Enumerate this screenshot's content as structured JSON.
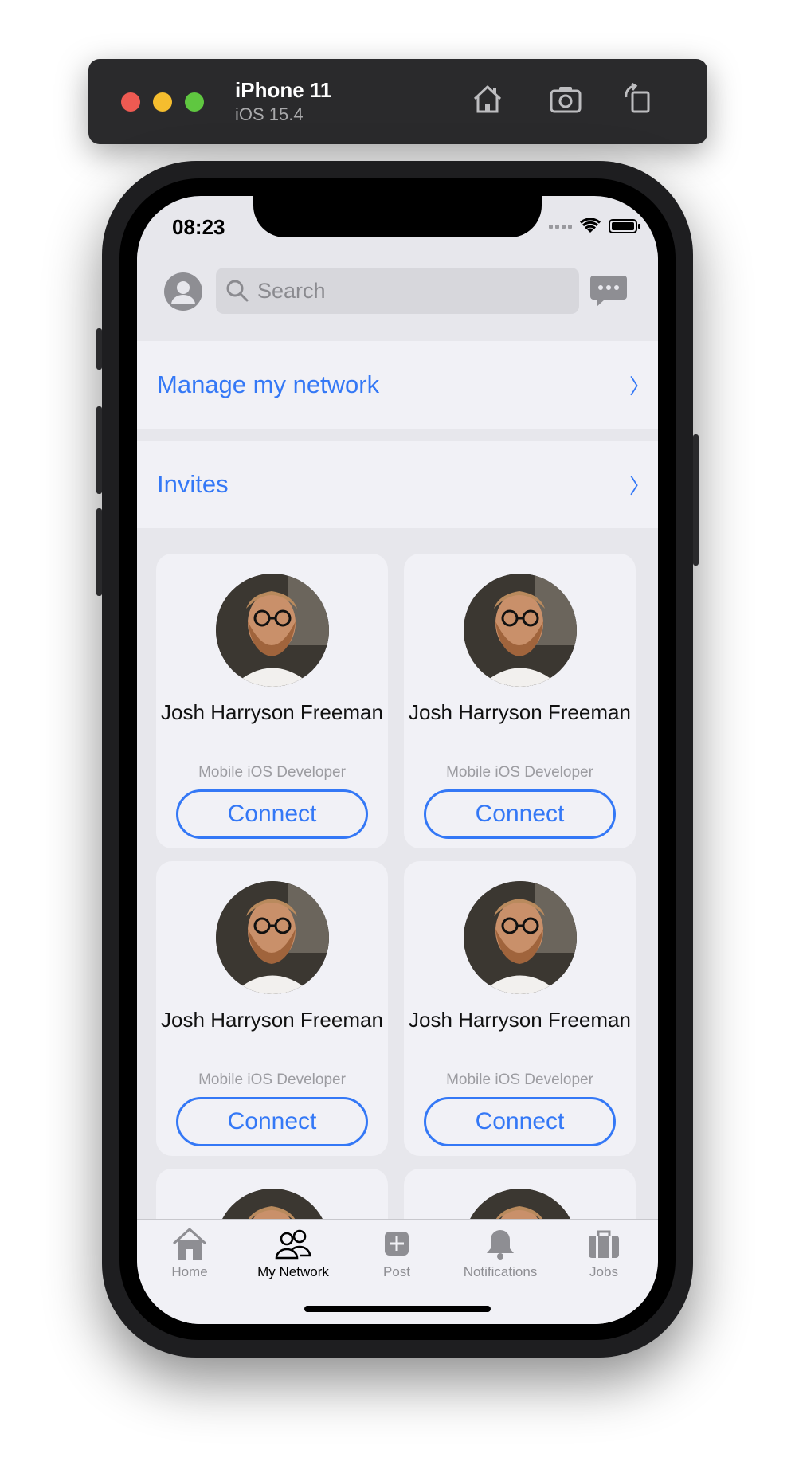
{
  "simulator": {
    "device": "iPhone 11",
    "os": "iOS 15.4",
    "icons": [
      "home-icon",
      "screenshot-icon",
      "rotate-icon"
    ]
  },
  "status_bar": {
    "time": "08:23"
  },
  "header": {
    "search_placeholder": "Search",
    "icons": [
      "profile-avatar-icon",
      "search-icon",
      "messages-icon"
    ]
  },
  "rows": [
    {
      "label": "Manage my network",
      "chevron": "〉"
    },
    {
      "label": "Invites",
      "chevron": "〉"
    }
  ],
  "cards": [
    {
      "name": "Josh Harryson Freeman",
      "role": "Mobile iOS Developer",
      "button": "Connect"
    },
    {
      "name": "Josh Harryson Freeman",
      "role": "Mobile iOS Developer",
      "button": "Connect"
    },
    {
      "name": "Josh Harryson Freeman",
      "role": "Mobile iOS Developer",
      "button": "Connect"
    },
    {
      "name": "Josh Harryson Freeman",
      "role": "Mobile iOS Developer",
      "button": "Connect"
    }
  ],
  "tabs": [
    {
      "label": "Home",
      "icon": "home-icon",
      "active": false
    },
    {
      "label": "My Network",
      "icon": "people-icon",
      "active": true
    },
    {
      "label": "Post",
      "icon": "plus-square-icon",
      "active": false
    },
    {
      "label": "Notifications",
      "icon": "bell-icon",
      "active": false
    },
    {
      "label": "Jobs",
      "icon": "briefcase-icon",
      "active": false
    }
  ],
  "colors": {
    "accent": "#3478f6",
    "background": "#e7e7ec",
    "card": "#f1f1f6"
  }
}
